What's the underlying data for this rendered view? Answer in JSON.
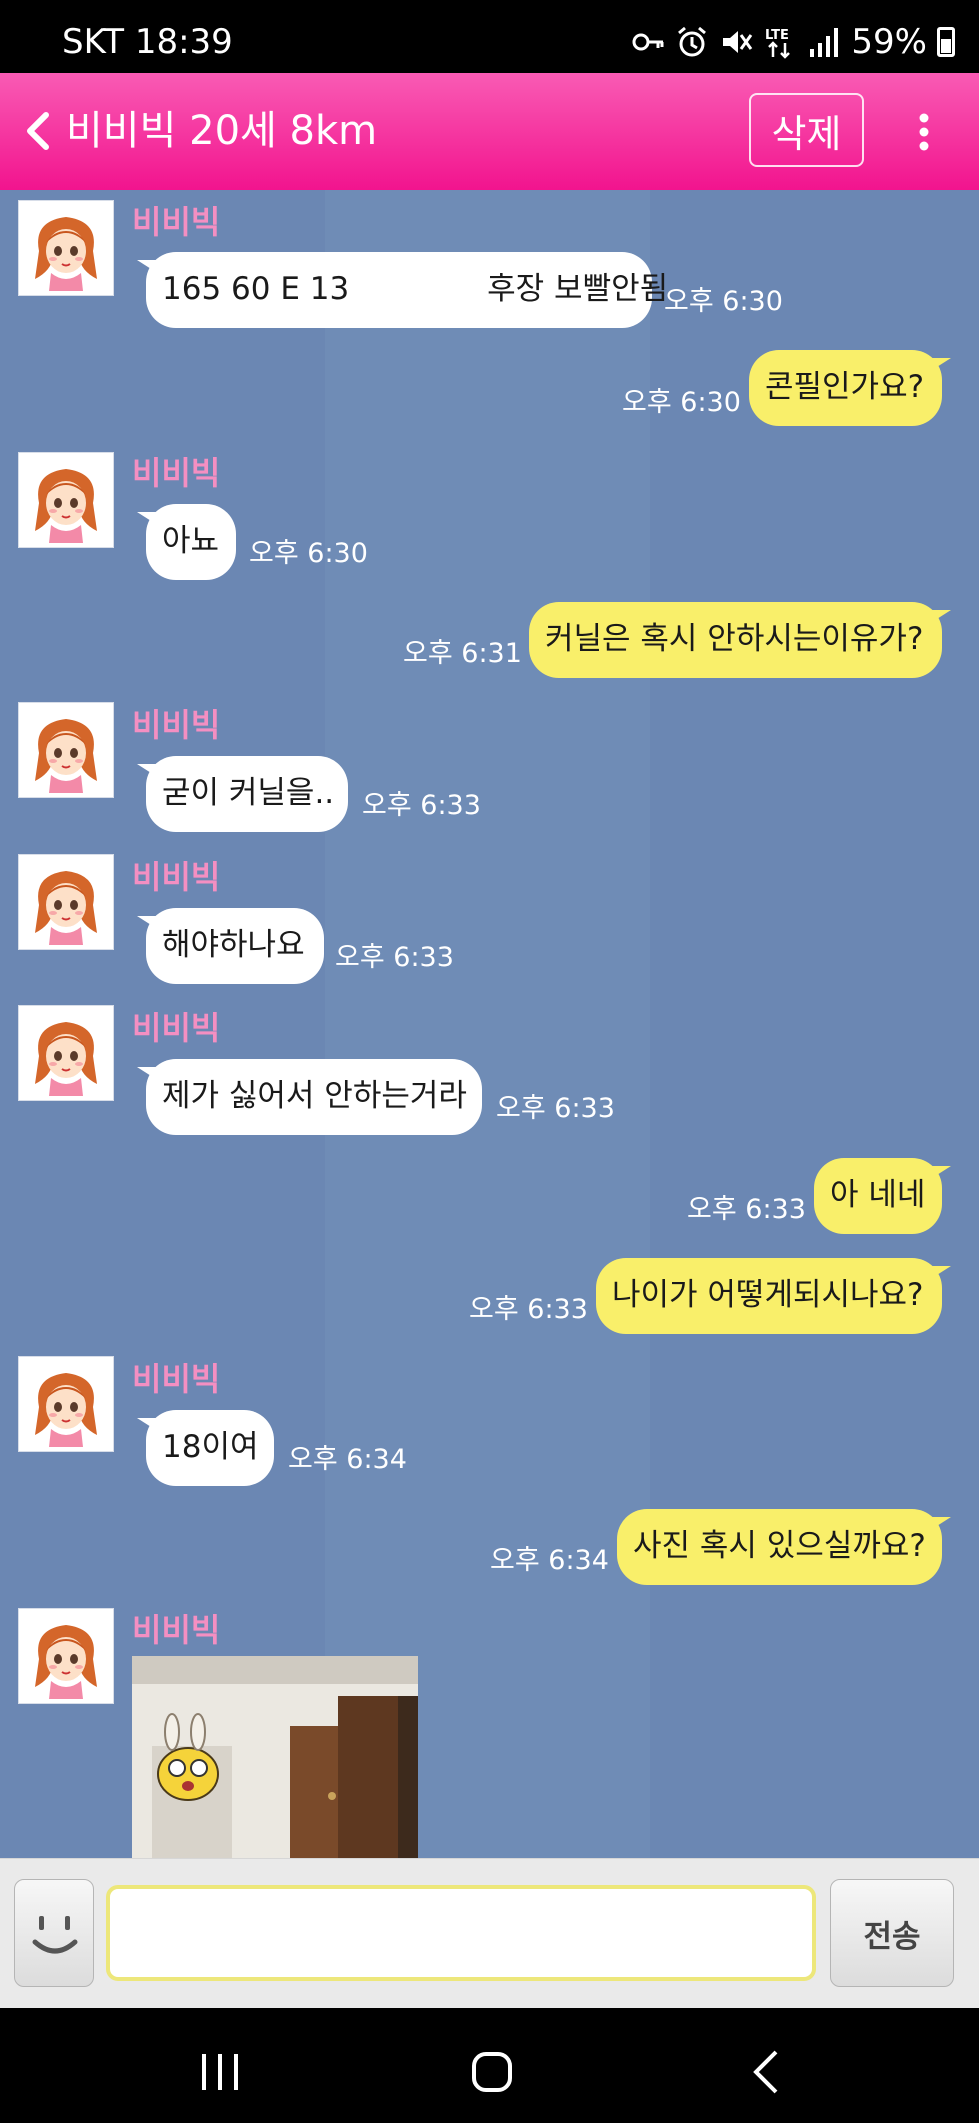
{
  "status_bar": {
    "carrier_time": "SKT 18:39",
    "battery": "59%",
    "icons": [
      "key-icon",
      "alarm-icon",
      "mute-icon",
      "lte-icon",
      "signal-icon",
      "battery-icon"
    ]
  },
  "header": {
    "title": "비비빅 20세 8km",
    "delete_label": "삭제"
  },
  "messages": [
    {
      "from": "other",
      "name": "비비빅",
      "text": "165 60 E 13              후장 보빨안됨",
      "time": "오후 6:30"
    },
    {
      "from": "me",
      "text": "콘필인가요?",
      "time": "오후 6:30"
    },
    {
      "from": "other",
      "name": "비비빅",
      "text": "아뇨",
      "time": "오후 6:30"
    },
    {
      "from": "me",
      "text": "커닐은 혹시 안하시는이유가?",
      "time": "오후 6:31"
    },
    {
      "from": "other",
      "name": "비비빅",
      "text": "굳이 커닐을..",
      "time": "오후 6:33"
    },
    {
      "from": "other",
      "name": "비비빅",
      "text": "해야하나요",
      "time": "오후 6:33"
    },
    {
      "from": "other",
      "name": "비비빅",
      "text": "제가 싫어서 안하는거라",
      "time": "오후 6:33"
    },
    {
      "from": "me",
      "text": "아 네네",
      "time": "오후 6:33"
    },
    {
      "from": "me",
      "text": "나이가 어떻게되시나요?",
      "time": "오후 6:33"
    },
    {
      "from": "other",
      "name": "비비빅",
      "text": "18이여",
      "time": "오후 6:34"
    },
    {
      "from": "me",
      "text": "사진 혹시 있으실까요?",
      "time": "오후 6:34"
    },
    {
      "from": "other",
      "name": "비비빅",
      "type": "photo"
    }
  ],
  "input": {
    "placeholder": "",
    "send_label": "전송"
  },
  "colors": {
    "header": "#f2148e",
    "chat_bg": "#6b87b3",
    "my_bubble": "#f9ef6a",
    "other_bubble": "#ffffff",
    "name": "#f48fc2"
  }
}
